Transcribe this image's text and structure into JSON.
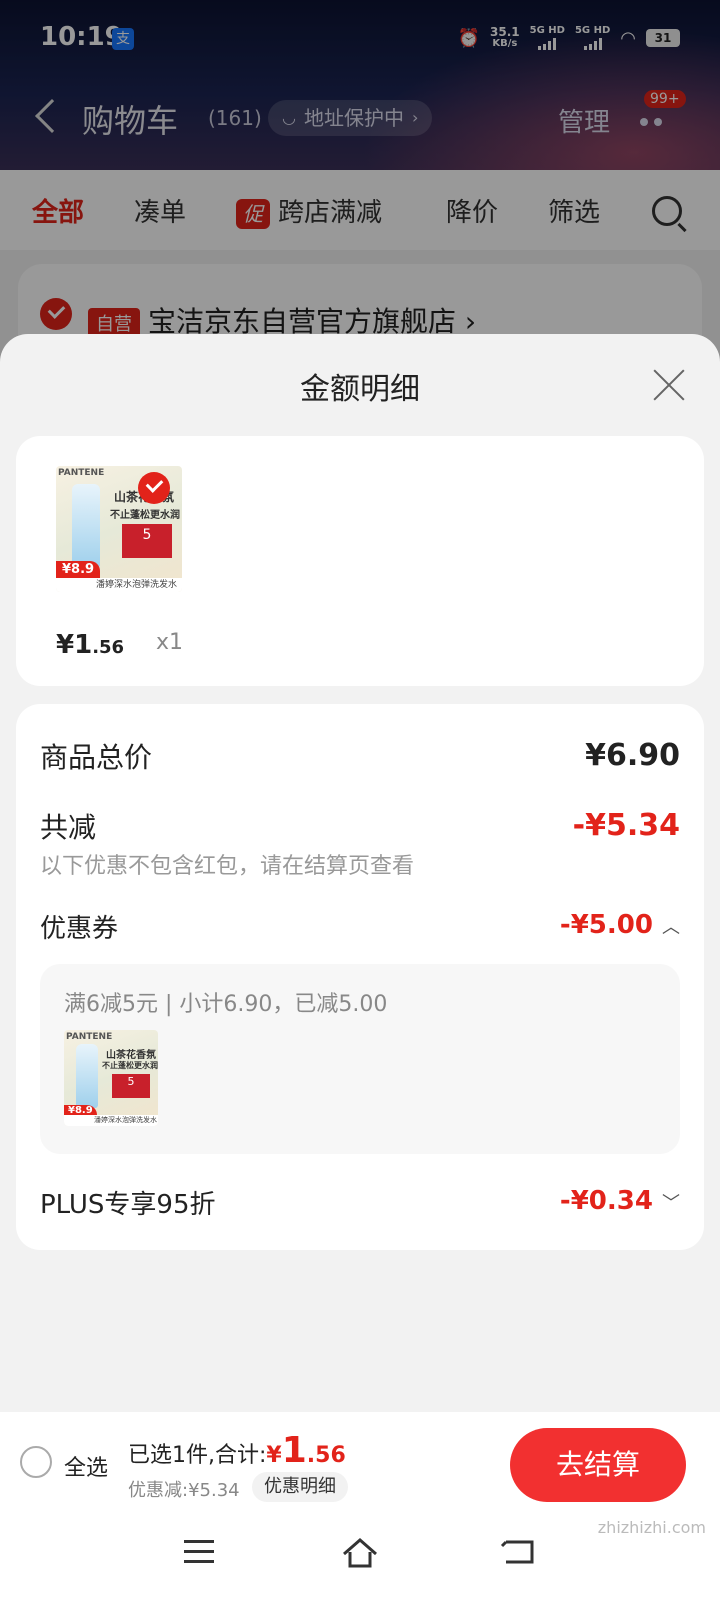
{
  "status_bar": {
    "time": "10:19",
    "app_icon_label": "支",
    "net_speed": "35.1",
    "net_unit": "KB/s",
    "sim1": "5G HD",
    "sim2": "5G HD",
    "battery": "31"
  },
  "nav": {
    "title": "购物车",
    "count": "(161)",
    "address_pill": "地址保护中",
    "manage": "管理",
    "badge": "99+"
  },
  "tabs": {
    "all": "全部",
    "combine": "凑单",
    "promo_tag": "促",
    "cross_store": "跨店满减",
    "price_drop": "降价",
    "filter": "筛选"
  },
  "store": {
    "self_tag": "自营",
    "name": "宝洁京东自营官方旗舰店"
  },
  "sheet": {
    "title": "金额明细",
    "product": {
      "brand": "PANTENE",
      "headline1": "山茶花香氛",
      "headline2": "不止蓬松更水润",
      "box_number": "5",
      "price_badge": "¥8.9",
      "strip_text": "潘婷深水泡弹洗发水",
      "price_int": "¥1",
      "price_dec": ".56",
      "qty": "x1"
    },
    "detail": {
      "total_label": "商品总价",
      "total_value": "¥6.90",
      "reduce_label": "共减",
      "reduce_value": "-¥5.34",
      "note": "以下优惠不包含红包，请在结算页查看",
      "coupon_label": "优惠券",
      "coupon_value": "-¥5.00",
      "coupon_desc": "满6减5元 | 小计6.90，已减5.00",
      "plus_label": "PLUS专享95折",
      "plus_value": "-¥0.34"
    }
  },
  "bottom": {
    "select_all": "全选",
    "selected_text": "已选1件,合计:",
    "sum_symbol": "¥",
    "sum_int": "1",
    "sum_dec": ".56",
    "discount": "优惠减:¥5.34",
    "detail_link": "优惠明细",
    "checkout": "去结算"
  },
  "watermark": "zhizhizhi.com",
  "colors": {
    "accent": "#e2231a",
    "checkout": "#f23030"
  }
}
